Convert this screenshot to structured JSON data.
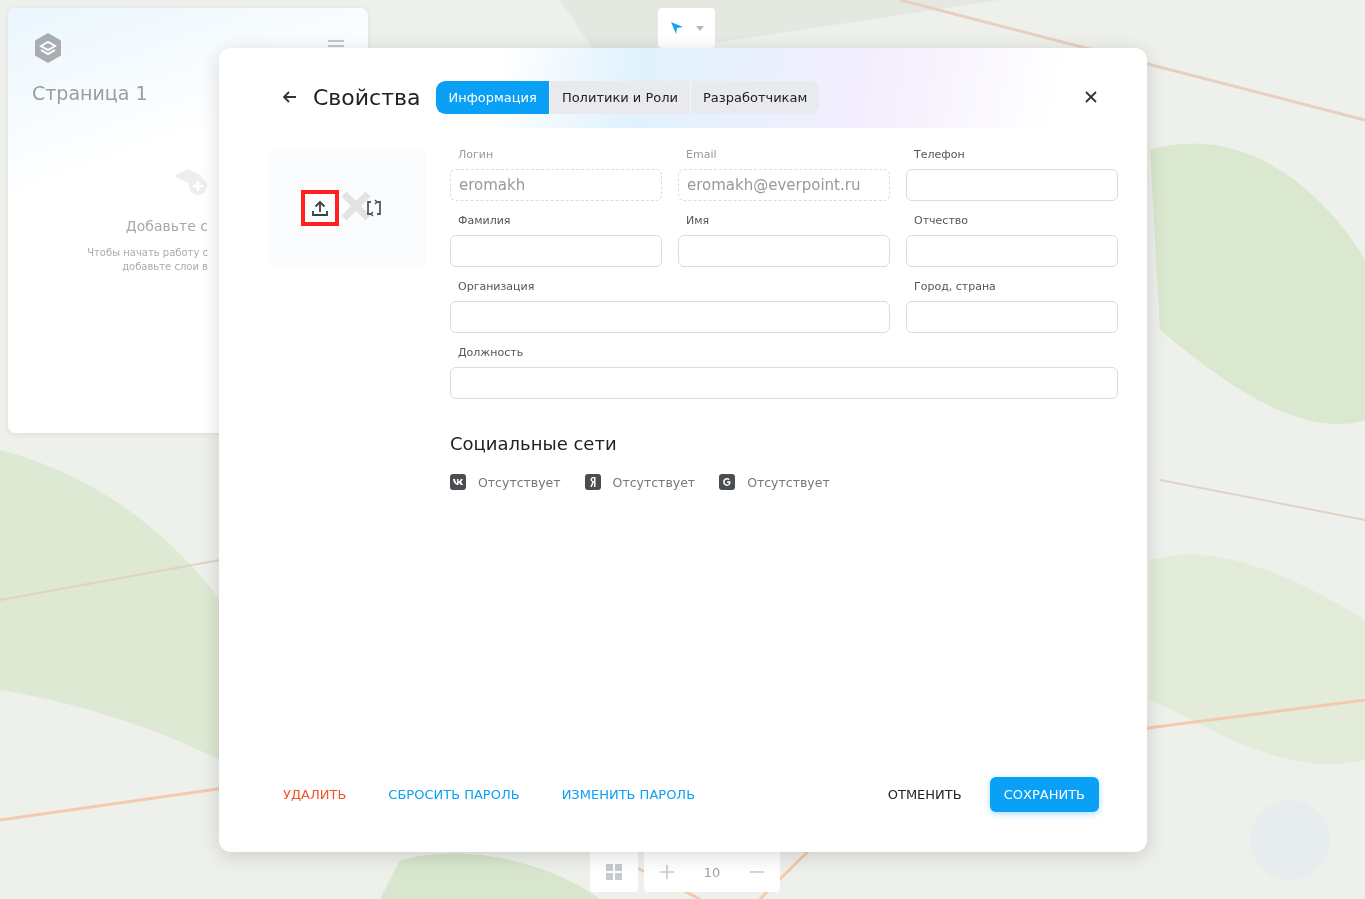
{
  "left_panel": {
    "title": "Страница 1",
    "empty_title": "Добавьте с",
    "empty_text": [
      "Чтобы начать работу с",
      "добавьте слои в"
    ]
  },
  "zoom_control": {
    "value": "10"
  },
  "dialog": {
    "title": "Свойства",
    "tabs": [
      {
        "label": "Информация",
        "selected": true
      },
      {
        "label": "Политики и Роли",
        "selected": false
      },
      {
        "label": "Разработчикам",
        "selected": false
      }
    ],
    "avatar": {
      "actions": [
        {
          "kind": "upload",
          "highlighted": true
        },
        {
          "kind": "refresh",
          "highlighted": false
        }
      ]
    },
    "fields": [
      {
        "label": "Логин",
        "value": "eromakh",
        "disabled": true,
        "kind": "short"
      },
      {
        "label": "Email",
        "value": "eromakh@everpoint.ru",
        "disabled": true,
        "kind": "short"
      },
      {
        "label": "Телефон",
        "disabled": false,
        "kind": "short"
      },
      {
        "label": "Фамилия",
        "disabled": false,
        "kind": "short"
      },
      {
        "label": "Имя",
        "disabled": false,
        "kind": "short"
      },
      {
        "label": "Отчество",
        "disabled": false,
        "kind": "short"
      },
      {
        "label": "Организация",
        "disabled": false,
        "kind": "wide"
      },
      {
        "label": "Город, страна",
        "disabled": false,
        "kind": "short"
      },
      {
        "label": "Должность",
        "disabled": false,
        "kind": "full"
      }
    ],
    "social": {
      "title": "Социальные сети",
      "accounts": [
        {
          "kind": "vk",
          "status": "Отсутствует"
        },
        {
          "kind": "yandex",
          "status": "Отсутствует"
        },
        {
          "kind": "google",
          "status": "Отсутствует"
        }
      ]
    },
    "actions": [
      {
        "label": "УДАЛИТЬ",
        "kind": "danger"
      },
      {
        "label": "СБРОСИТЬ ПАРОЛЬ",
        "kind": "link"
      },
      {
        "label": "ИЗМЕНИТЬ ПАРОЛЬ",
        "kind": "link"
      },
      {
        "label": "ОТМЕНИТЬ",
        "kind": "plain"
      },
      {
        "label": "СОХРАНИТЬ",
        "kind": "primary"
      }
    ]
  }
}
